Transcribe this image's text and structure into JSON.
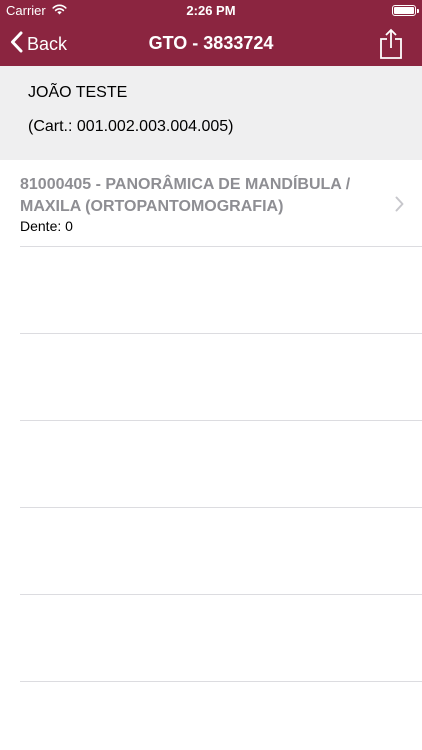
{
  "status_bar": {
    "carrier": "Carrier",
    "time": "2:26 PM"
  },
  "nav": {
    "back_label": "Back",
    "title": "GTO - 3833724"
  },
  "patient": {
    "name": "JOÃO TESTE",
    "card": "(Cart.: 001.002.003.004.005)"
  },
  "procedures": [
    {
      "title": "81000405 - PANORÂMICA DE MANDÍBULA / MAXILA (ORTOPANTOMOGRAFIA)",
      "tooth": "Dente: 0"
    }
  ],
  "colors": {
    "nav_background": "#8b2540",
    "header_background": "#efeff0",
    "procedure_text": "#8e8e93"
  },
  "icons": {
    "back": "chevron-left-icon",
    "share": "share-icon",
    "disclosure": "chevron-right-icon",
    "wifi": "wifi-icon",
    "battery": "battery-icon"
  },
  "battery_level": 1.0
}
